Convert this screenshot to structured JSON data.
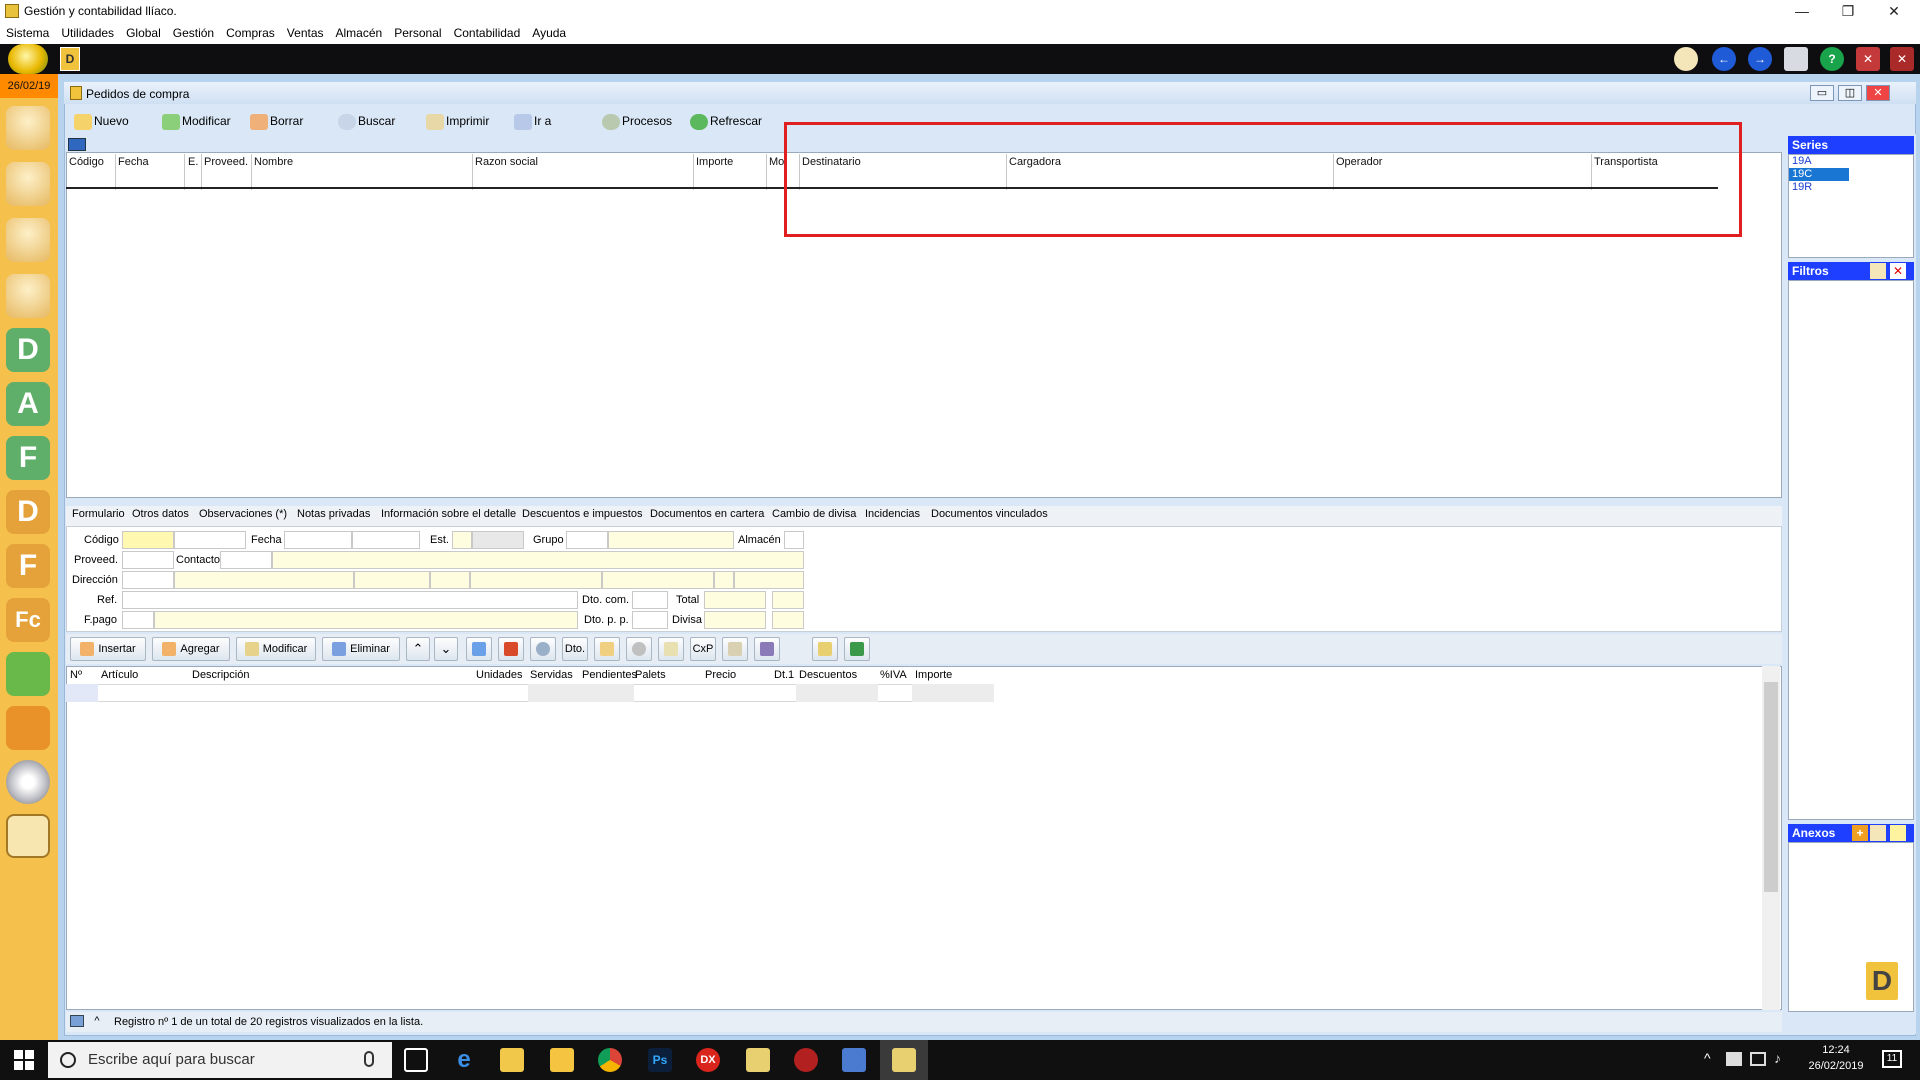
{
  "window": {
    "title": "Gestión y contabilidad llíaco.",
    "controls": [
      "—",
      "❐",
      "✕"
    ]
  },
  "menu": [
    "Sistema",
    "Utilidades",
    "Global",
    "Gestión",
    "Compras",
    "Ventas",
    "Almacén",
    "Personal",
    "Contabilidad",
    "Ayuda"
  ],
  "date_badge": "26/02/19",
  "top_icons": [
    "mail-icon",
    "back-arrow-icon",
    "forward-arrow-icon",
    "windows-icon",
    "help-icon",
    "close-window-icon",
    "close-all-icon"
  ],
  "left_bar": [
    "users-icon",
    "user-icon",
    "user-r-icon",
    "user-a-icon",
    "letter-d-icon",
    "letter-a-icon",
    "letter-f-icon",
    "letter-d2-icon",
    "letter-f2-icon",
    "letter-fc-icon",
    "box-green-icon",
    "box-orange-icon",
    "disc-key-icon",
    "mail-open-icon"
  ],
  "mdi": {
    "title": "Pedidos de compra",
    "controls": [
      "▭",
      "◫",
      "✕"
    ]
  },
  "toolbar": {
    "nuevo": "Nuevo",
    "modificar": "Modificar",
    "borrar": "Borrar",
    "buscar": "Buscar",
    "imprimir": "Imprimir",
    "ir_a": "Ir a",
    "procesos": "Procesos",
    "refrescar": "Refrescar"
  },
  "grid": {
    "columns": [
      "Código",
      "Fecha",
      "E.",
      "Proveed.",
      "Nombre",
      "Razon social",
      "Importe",
      "Mo.",
      "Destinatario",
      "Cargadora",
      "Operador",
      "Transportista"
    ]
  },
  "tabs": [
    "Formulario",
    "Otros datos",
    "Observaciones (*)",
    "Notas privadas",
    "Información sobre el detalle",
    "Descuentos e impuestos",
    "Documentos en cartera",
    "Cambio de divisa",
    "Incidencias",
    "Documentos vinculados"
  ],
  "form": {
    "codigo": "Código",
    "fecha": "Fecha",
    "est": "Est.",
    "grupo": "Grupo",
    "almacen": "Almacén",
    "proveed": "Proveed.",
    "contacto": "Contacto",
    "direccion": "Dirección",
    "ref": "Ref.",
    "fpago": "F.pago",
    "dto_com": "Dto. com.",
    "total": "Total",
    "dto_pp": "Dto. p. p.",
    "divisa": "Divisa"
  },
  "detail_buttons": {
    "insertar": "Insertar",
    "agregar": "Agregar",
    "modificar": "Modificar",
    "eliminar": "Eliminar",
    "up": "⌃",
    "down": "⌄",
    "dto": "Dto.",
    "cxp": "CxP"
  },
  "detail": {
    "columns": [
      "Nº",
      "Artículo",
      "Descripción",
      "Unidades",
      "Servidas",
      "Pendientes",
      "Palets",
      "Precio",
      "Dt.1",
      "Descuentos",
      "%IVA",
      "Importe"
    ]
  },
  "status": "Registro nº 1 de un total de 20 registros visualizados en la lista.",
  "series": {
    "title": "Series",
    "items": [
      "19A",
      "19C",
      "19R"
    ],
    "selected": "19C"
  },
  "filtros": {
    "title": "Filtros"
  },
  "anexos": {
    "title": "Anexos"
  },
  "taskbar": {
    "search_placeholder": "Escribe aquí para buscar",
    "time": "12:24",
    "date": "26/02/2019",
    "notif": "11"
  }
}
